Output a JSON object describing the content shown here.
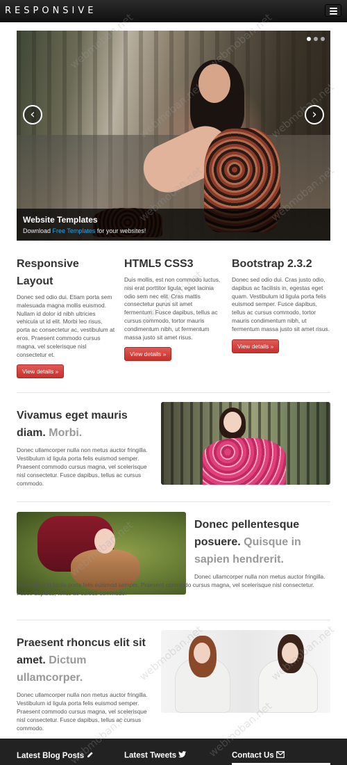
{
  "navbar": {
    "brand": "RESPONSIVE"
  },
  "carousel": {
    "caption_title": "Website Templates",
    "caption_prefix": "Download ",
    "caption_link": "Free Templates",
    "caption_suffix": " for your websites!",
    "prev_glyph": "‹",
    "next_glyph": "›",
    "slide_count": 3,
    "active_slide": 1
  },
  "columns": [
    {
      "title": "Responsive Layout",
      "text": "Donec sed odio dui. Etiam porta sem malesuada magna mollis euismod. Nullam id dolor id nibh ultricies vehicula ut id elit. Morbi leo risus, porta ac consectetur ac, vestibulum at eros. Praesent commodo cursus magna, vel scelerisque nisl consectetur et.",
      "button": "View details »"
    },
    {
      "title": "HTML5 CSS3",
      "text": "Duis mollis, est non commodo luctus, nisi erat porttitor ligula, eget lacinia odio sem nec elit. Cras mattis consectetur purus sit amet fermentum. Fusce dapibus, tellus ac cursus commodo, tortor mauris condimentum nibh, ut fermentum massa justo sit amet risus.",
      "button": "View details »"
    },
    {
      "title": "Bootstrap 2.3.2",
      "text": "Donec sed odio dui. Cras justo odio, dapibus ac facilisis in, egestas eget quam. Vestibulum id ligula porta felis euismod semper. Fusce dapibus, tellus ac cursus commodo, tortor mauris condimentum nibh, ut fermentum massa justo sit amet risus.",
      "button": "View details »"
    }
  ],
  "featurettes": [
    {
      "heading": "Vivamus eget mauris diam.",
      "muted": "Morbi.",
      "text": "Donec ullamcorper nulla non metus auctor fringilla. Vestibulum id ligula porta felis euismod semper. Praesent commodo cursus magna, vel scelerisque nisl consectetur. Fusce dapibus, tellus ac cursus commodo."
    },
    {
      "heading": "Donec pellentesque posuere.",
      "muted": "Quisque in sapien hendrerit.",
      "text": "Donec ullamcorper nulla non metus auctor fringilla. Vestibulum id ligula porta felis euismod semper. Praesent commodo cursus magna, vel scelerisque nisl consectetur. Fusce dapibus, tellus ac cursus commodo."
    },
    {
      "heading": "Praesent rhoncus elit sit amet.",
      "muted": "Dictum ullamcorper.",
      "text": "Donec ullamcorper nulla non metus auctor fringilla. Vestibulum id ligula porta felis euismod semper. Praesent commodo cursus magna, vel scelerisque nisl consectetur. Fusce dapibus, tellus ac cursus commodo."
    }
  ],
  "footer": {
    "blog_title": "Latest Blog Posts",
    "blog_icon": "pencil-icon",
    "tweets_title": "Latest Tweets",
    "tweets_icon": "twitter-icon",
    "contact_title": "Contact Us",
    "contact_icon": "envelope-icon"
  },
  "watermark": "webmoban.net",
  "colors": {
    "accent_red": "#d9534f",
    "link_blue": "#2aa3e0",
    "navbar": "#1b1b1b",
    "footer": "#222222"
  }
}
